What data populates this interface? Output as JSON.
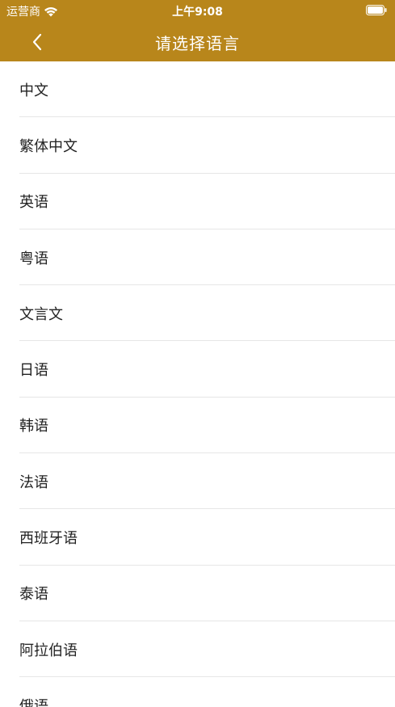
{
  "status_bar": {
    "carrier": "运营商",
    "time": "上午9:08"
  },
  "nav": {
    "title": "请选择语言"
  },
  "colors": {
    "header_bg": "#b8861b",
    "header_text": "#ffffff",
    "divider": "#e6e6e6",
    "item_text": "#222222"
  },
  "languages": [
    {
      "label": "中文"
    },
    {
      "label": "繁体中文"
    },
    {
      "label": "英语"
    },
    {
      "label": "粤语"
    },
    {
      "label": "文言文"
    },
    {
      "label": "日语"
    },
    {
      "label": "韩语"
    },
    {
      "label": "法语"
    },
    {
      "label": "西班牙语"
    },
    {
      "label": "泰语"
    },
    {
      "label": "阿拉伯语"
    },
    {
      "label": "俄语"
    }
  ]
}
